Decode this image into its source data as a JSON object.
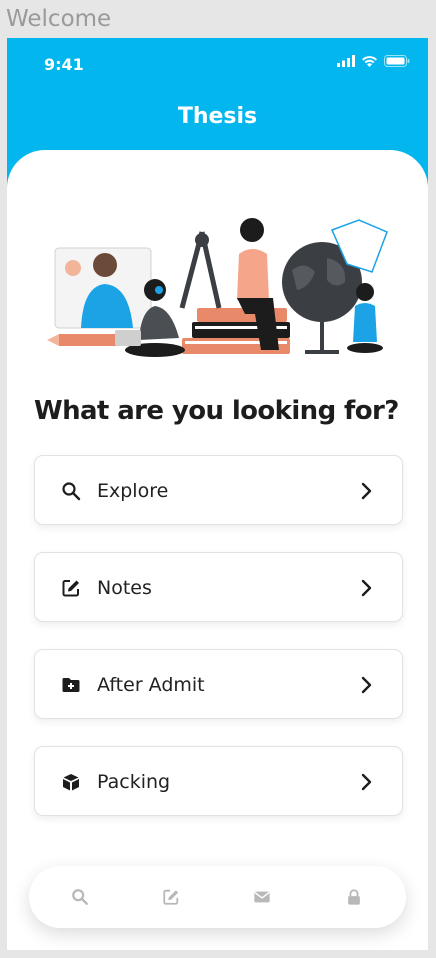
{
  "frame_label": "Welcome",
  "status_bar": {
    "time": "9:41"
  },
  "header": {
    "title": "Thesis"
  },
  "main": {
    "heading": "What are you looking for?",
    "options": [
      {
        "label": "Explore",
        "icon": "search-icon"
      },
      {
        "label": "Notes",
        "icon": "edit-icon"
      },
      {
        "label": "After Admit",
        "icon": "folder-plus-icon"
      },
      {
        "label": "Packing",
        "icon": "box-icon"
      }
    ]
  },
  "bottom_nav": {
    "items": [
      {
        "icon": "search-icon"
      },
      {
        "icon": "edit-icon"
      },
      {
        "icon": "mail-icon"
      },
      {
        "icon": "lock-icon"
      }
    ]
  },
  "colors": {
    "accent": "#04b6ee",
    "nav_icon": "#b8b8b8",
    "text": "#1d1d1d"
  }
}
